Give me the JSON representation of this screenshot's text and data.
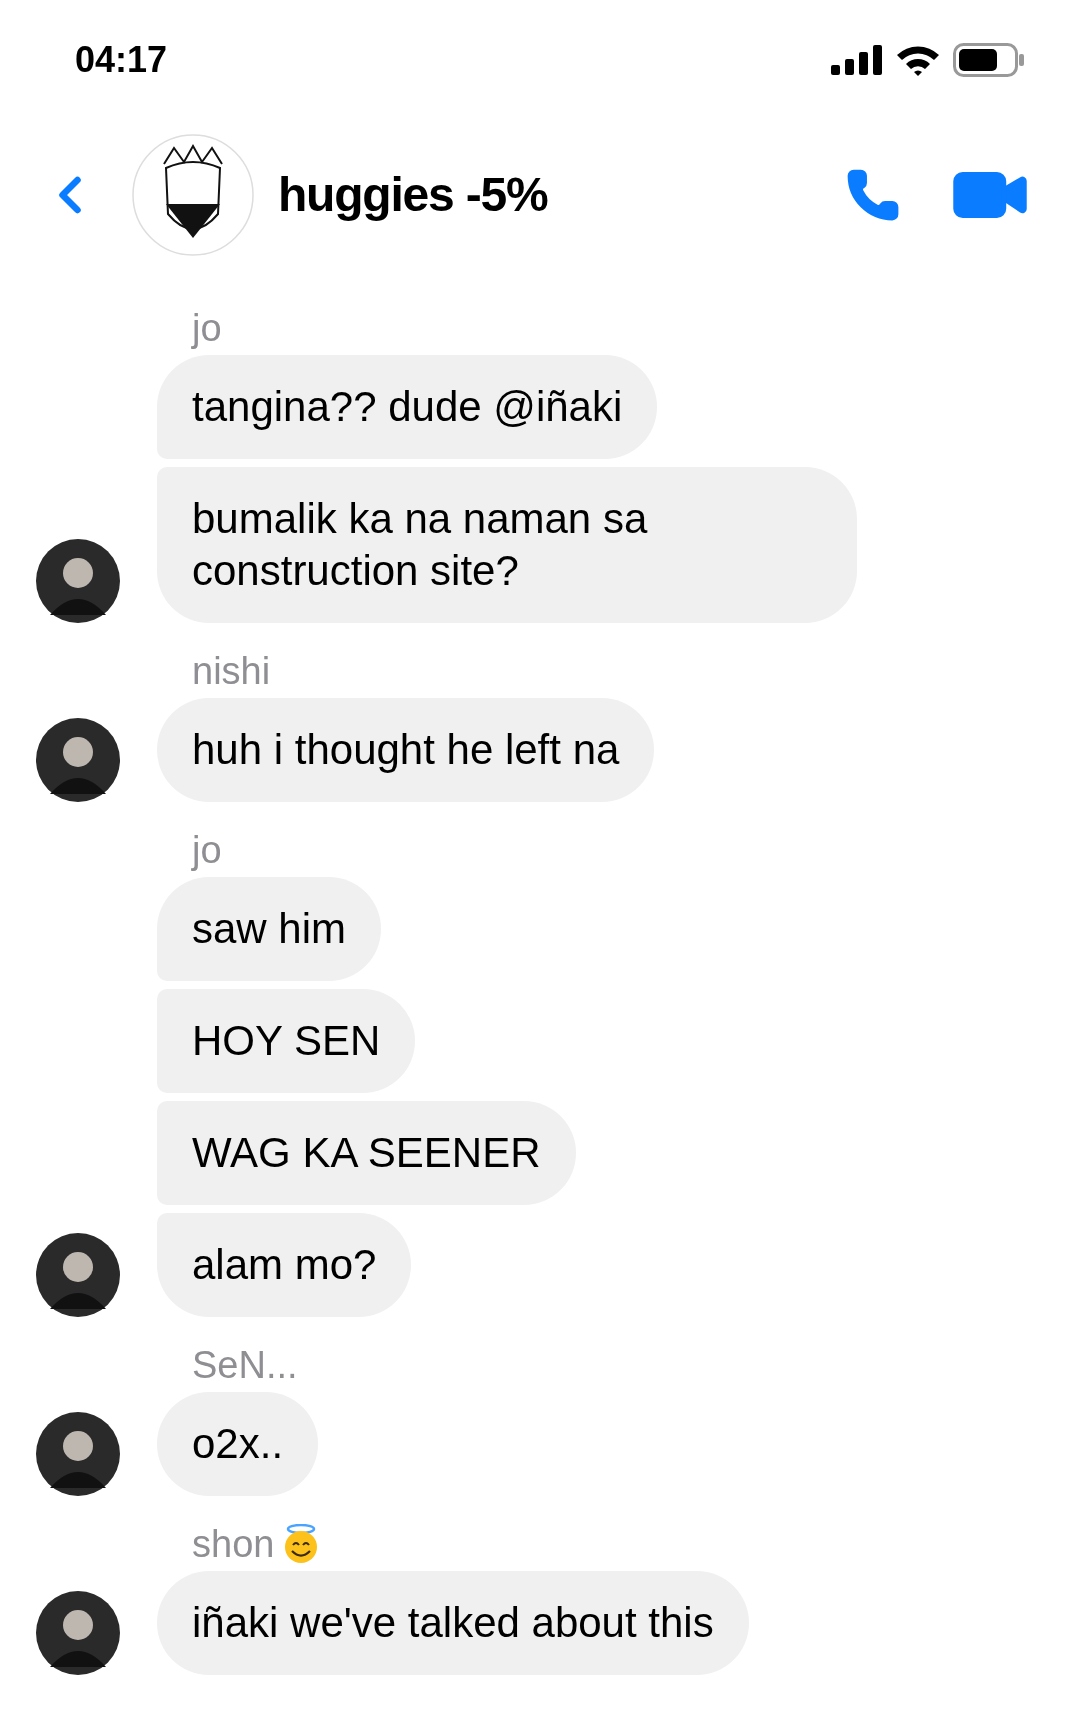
{
  "status_bar": {
    "time": "04:17"
  },
  "header": {
    "title": "huggies -5%"
  },
  "groups": [
    {
      "sender": "jo",
      "emoji": false,
      "messages": [
        "tangina?? dude @iñaki",
        "bumalik ka na naman sa construction site?"
      ]
    },
    {
      "sender": "nishi",
      "emoji": false,
      "messages": [
        "huh i thought he left na"
      ]
    },
    {
      "sender": "jo",
      "emoji": false,
      "messages": [
        "saw him",
        "HOY SEN",
        "WAG KA SEENER",
        "alam mo?"
      ]
    },
    {
      "sender": "SeN...",
      "emoji": false,
      "messages": [
        "o2x.."
      ]
    },
    {
      "sender": "shon",
      "emoji": true,
      "messages": [
        "iñaki we've talked about this"
      ]
    }
  ]
}
